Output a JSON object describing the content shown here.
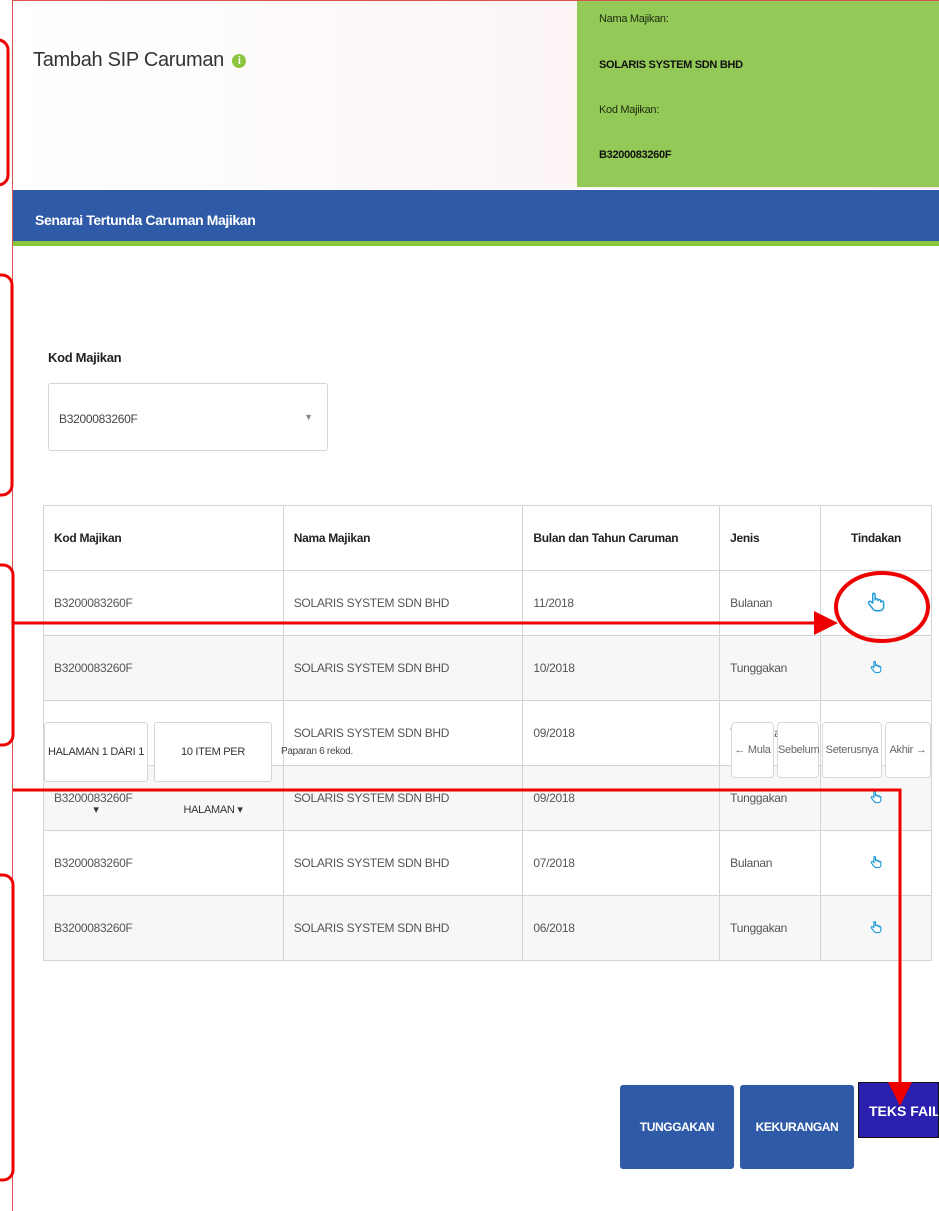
{
  "header": {
    "title": "Tambah SIP Caruman",
    "info_icon": "i",
    "employer_name_label": "Nama Majikan:",
    "employer_name": "SOLARIS SYSTEM SDN BHD",
    "employer_code_label": "Kod Majikan:",
    "employer_code": "B3200083260F"
  },
  "section": {
    "title": "Senarai Tertunda Caruman Majikan"
  },
  "filter": {
    "label": "Kod Majikan",
    "selected": "B3200083260F"
  },
  "table": {
    "columns": [
      "Kod Majikan",
      "Nama Majikan",
      "Bulan dan Tahun Caruman",
      "Jenis",
      "Tindakan"
    ],
    "rows": [
      [
        "B3200083260F",
        "SOLARIS SYSTEM SDN BHD",
        "11/2018",
        "Bulanan"
      ],
      [
        "B3200083260F",
        "SOLARIS SYSTEM SDN BHD",
        "10/2018",
        "Tunggakan"
      ],
      [
        "B3200083260F",
        "SOLARIS SYSTEM SDN BHD",
        "09/2018",
        "Tunggakan"
      ],
      [
        "B3200083260F",
        "SOLARIS SYSTEM SDN BHD",
        "09/2018",
        "Tunggakan"
      ],
      [
        "B3200083260F",
        "SOLARIS SYSTEM SDN BHD",
        "07/2018",
        "Bulanan"
      ],
      [
        "B3200083260F",
        "SOLARIS SYSTEM SDN BHD",
        "06/2018",
        "Tunggakan"
      ]
    ],
    "action_icon": "pointing-hand-icon"
  },
  "pagination": {
    "page": "HALAMAN 1 DARI 1",
    "per_page": "10 ITEM PER HALAMAN",
    "info": "Paparan 6 rekod.",
    "first": "← Mula",
    "prev": "Sebelum",
    "next": "Seterusnya",
    "last": "Akhir →"
  },
  "actions": {
    "tunggakan": "TUNGGAKAN CARUMAN",
    "kekurangan": "KEKURANGAN CARUMAN",
    "teks_fail": "TEKS FAIL"
  },
  "colors": {
    "accent_blue": "#2e5aa8",
    "accent_green": "#92c957",
    "annotation_red": "#ee0000",
    "icon_blue": "#1e9ad6"
  }
}
